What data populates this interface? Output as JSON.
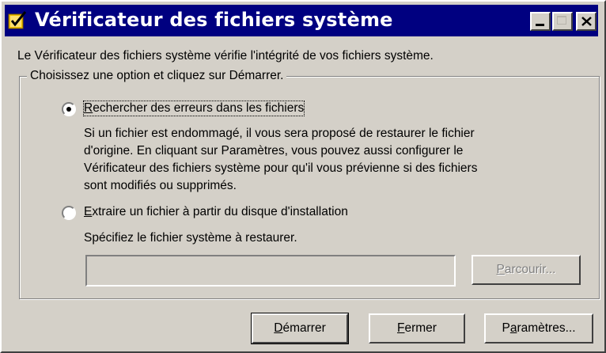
{
  "window": {
    "title": "Vérificateur des fichiers système",
    "colors": {
      "titlebar": "#000080",
      "face": "#d4d0c8"
    }
  },
  "intro_text": "Le Vérificateur des fichiers système vérifie l'intégrité de vos fichiers système.",
  "group": {
    "legend": "Choisissez une option et cliquez sur Démarrer.",
    "option1": {
      "mnemonic": "R",
      "label_rest": "echercher des erreurs dans les fichiers",
      "selected": true,
      "description": [
        "Si un fichier est endommagé, il vous sera proposé de restaurer le fichier",
        "d'origine. En cliquant sur Paramètres, vous pouvez aussi configurer le",
        "Vérificateur des fichiers système pour qu'il vous prévienne si des fichiers",
        "sont modifiés ou supprimés."
      ]
    },
    "option2": {
      "mnemonic": "E",
      "label_rest": "xtraire un fichier à partir du disque d'installation",
      "selected": false,
      "instruction": "Spécifiez le fichier système à restaurer.",
      "file_value": "",
      "browse": {
        "mnemonic": "P",
        "rest": "arcourir..."
      }
    }
  },
  "buttons": {
    "start": {
      "mnemonic": "D",
      "rest": "émarrer"
    },
    "close": {
      "mnemonic": "F",
      "rest": "ermer"
    },
    "settings": {
      "prefix": "P",
      "mnemonic": "a",
      "rest": "ramètres..."
    }
  }
}
